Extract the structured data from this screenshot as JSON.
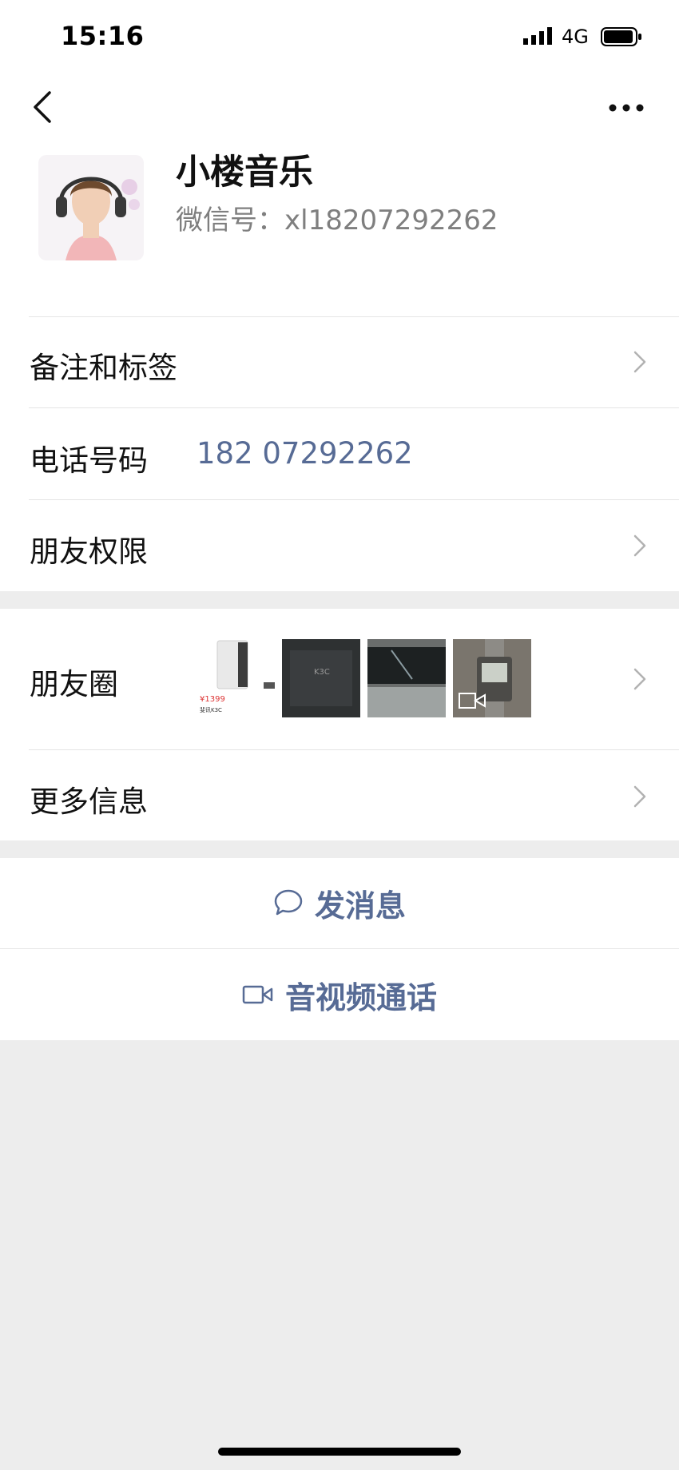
{
  "status_bar": {
    "time": "15:16",
    "network": "4G",
    "signal_icon": "signal-bars-icon",
    "battery_icon": "battery-icon"
  },
  "nav": {
    "back_icon": "chevron-left-icon",
    "more_icon": "more-dots-icon"
  },
  "profile": {
    "name": "小楼音乐",
    "wechat_id": "微信号：xl18207292262"
  },
  "rows": {
    "remarks_label": "备注和标签",
    "phone_label": "电话号码",
    "phone_value": "182 07292262",
    "permissions_label": "朋友权限",
    "moments_label": "朋友圈",
    "more_info_label": "更多信息"
  },
  "moments_thumbs": {
    "thumb1_price": "¥1399",
    "thumb1_caption": "斐讯K3C",
    "thumb2_brand": "K3C"
  },
  "actions": {
    "message_label": "发消息",
    "call_label": "音视频通话"
  },
  "colors": {
    "accent": "#576b95",
    "background": "#ededed",
    "divider": "#e5e5e5"
  }
}
